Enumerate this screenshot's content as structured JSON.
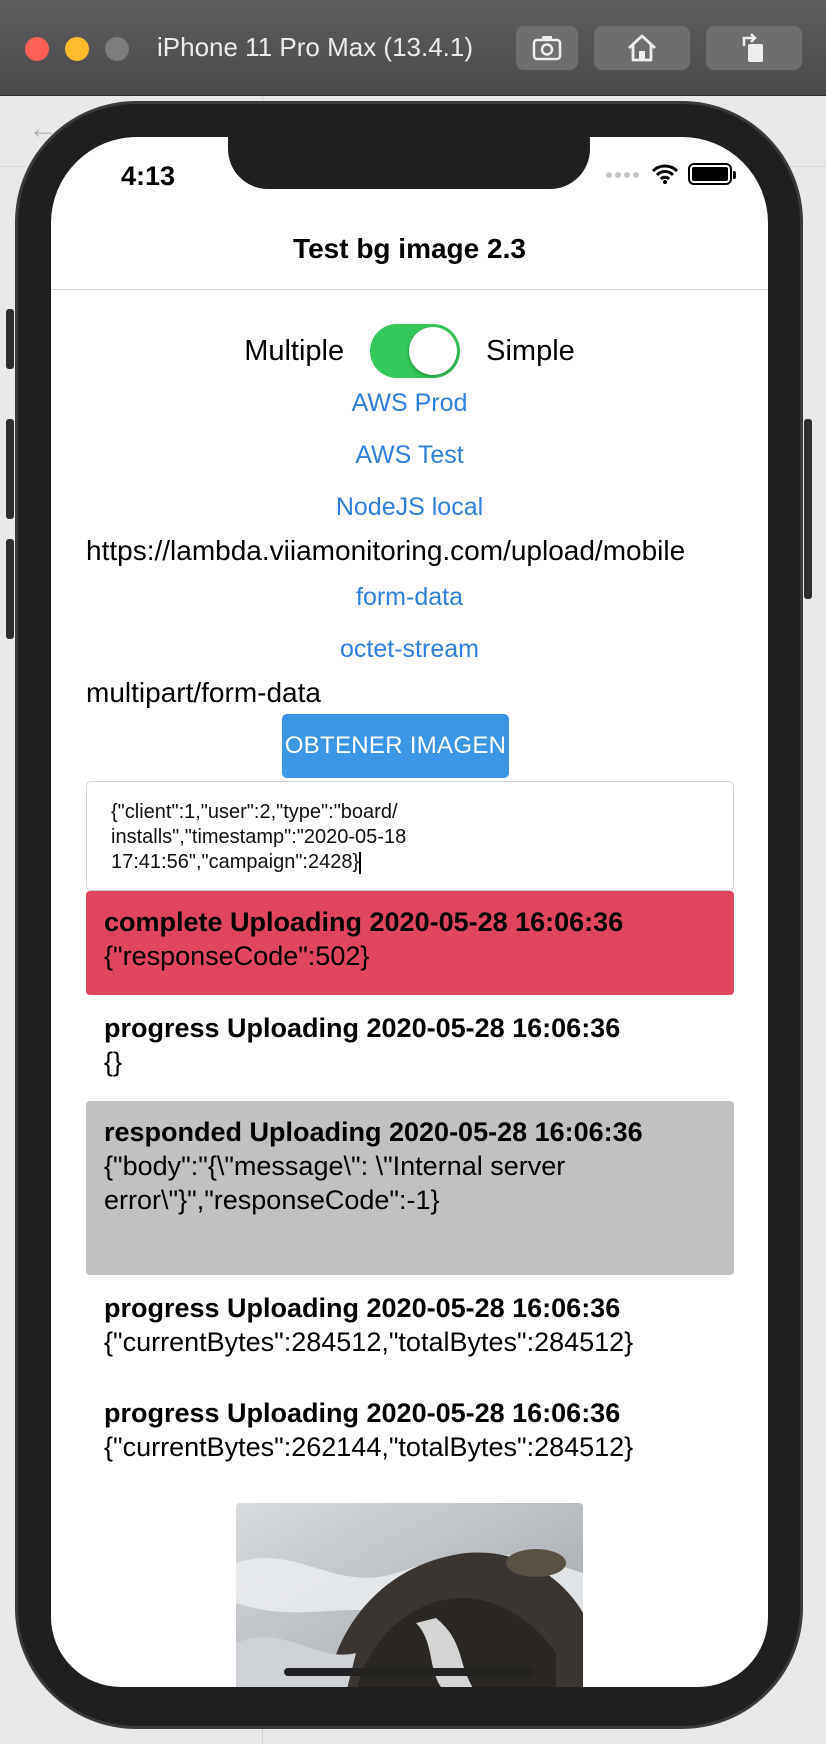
{
  "simulator": {
    "title": "iPhone 11 Pro Max (13.4.1)",
    "buttons": [
      {
        "icon": "screenshot-icon"
      },
      {
        "icon": "home-icon"
      },
      {
        "icon": "rotate-icon"
      }
    ]
  },
  "status_bar": {
    "time": "4:13"
  },
  "nav": {
    "title": "Test bg image 2.3"
  },
  "toggle": {
    "left_label": "Multiple",
    "right_label": "Simple",
    "on": true
  },
  "endpoints": {
    "aws_prod": "AWS Prod",
    "aws_test": "AWS Test",
    "node_local": "NodeJS local",
    "current_url": "https://lambda.viiamonitoring.com/upload/mobile"
  },
  "content_types": {
    "form_data": "form-data",
    "octet_stream": "octet-stream",
    "current": "multipart/form-data"
  },
  "action": {
    "get_image_label": "OBTENER IMAGEN"
  },
  "json_input": {
    "line1": "{\"client\":1,\"user\":2,\"type\":\"board/",
    "line2": "installs\",\"timestamp\":\"2020-05-18",
    "line3": "17:41:56\",\"campaign\":2428}"
  },
  "logs": [
    {
      "header": "complete Uploading 2020-05-28 16:06:36",
      "body": "{\"responseCode\":502}",
      "style": "error"
    },
    {
      "header": "progress Uploading 2020-05-28 16:06:36",
      "body": "{}",
      "style": "plain"
    },
    {
      "header": "responded Uploading 2020-05-28 16:06:36",
      "body": "{\"body\":\"{\\\"message\\\": \\\"Internal server error\\\"}\",\"responseCode\":-1}",
      "style": "gray"
    },
    {
      "header": "progress Uploading 2020-05-28 16:06:36",
      "body": "{\"currentBytes\":284512,\"totalBytes\":284512}",
      "style": "plain"
    },
    {
      "header": "progress Uploading 2020-05-28 16:06:36",
      "body": "{\"currentBytes\":262144,\"totalBytes\":284512}",
      "style": "plain"
    }
  ],
  "colors": {
    "link": "#2f80dc",
    "switch_on": "#34c759",
    "button": "#3c96e6",
    "error_bg": "#e0475f",
    "responded_bg": "#c1c1c1"
  }
}
